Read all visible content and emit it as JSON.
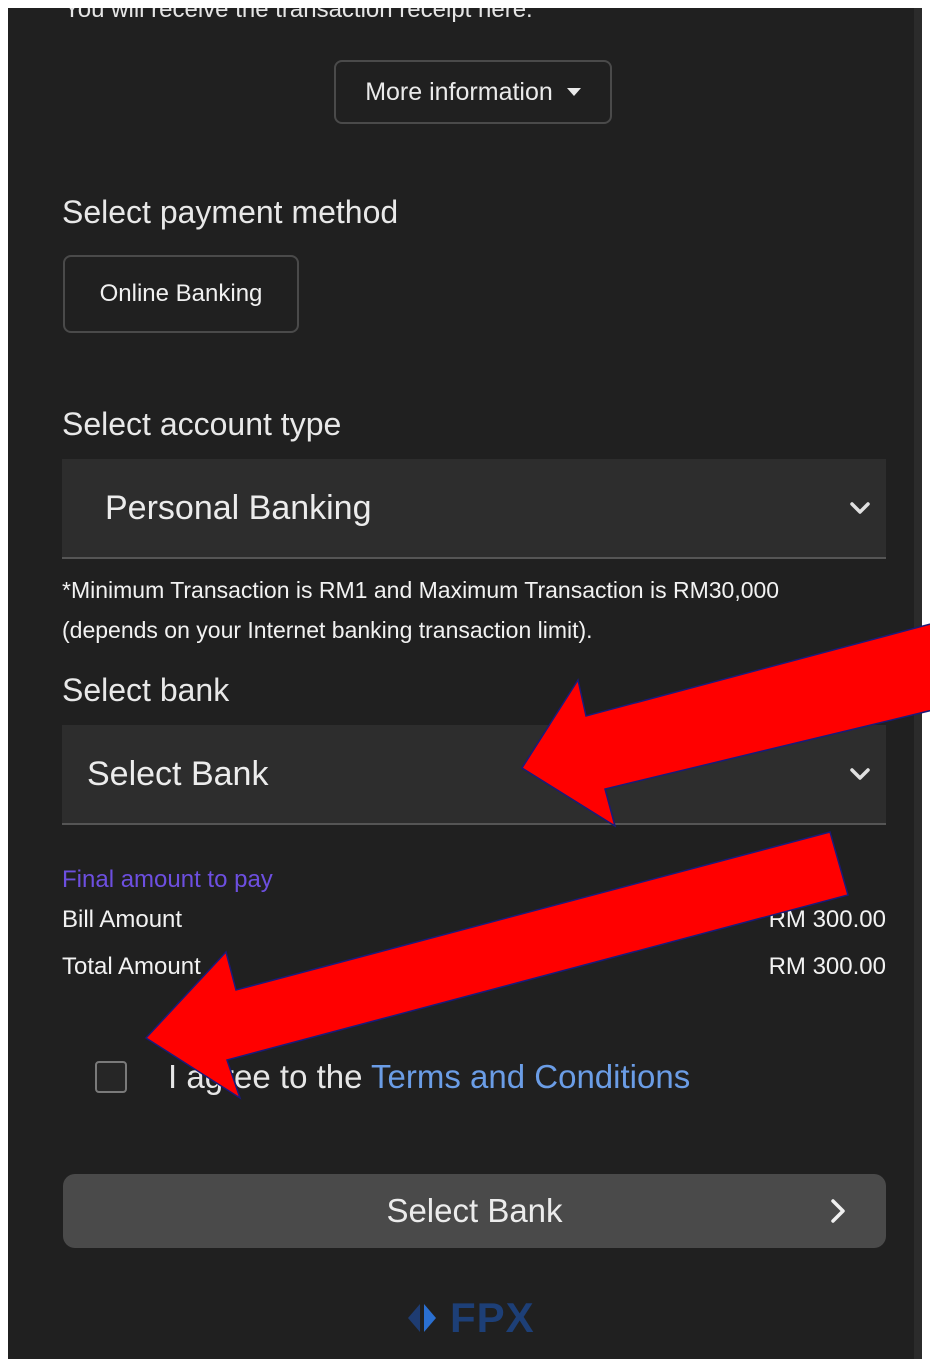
{
  "receipt_note": "You will receive the transaction receipt here.",
  "more_info": {
    "label": "More information"
  },
  "payment_method": {
    "title": "Select payment method",
    "option": "Online Banking"
  },
  "account_type": {
    "title": "Select account type",
    "selected": "Personal Banking"
  },
  "transaction_note": "*Minimum Transaction is RM1 and Maximum Transaction is RM30,000 (depends on your Internet banking transaction limit).",
  "bank": {
    "title": "Select bank",
    "selected": "Select Bank"
  },
  "final_amount": {
    "label": "Final amount to pay",
    "bill_label": "Bill Amount",
    "bill_value": "RM 300.00",
    "total_label": "Total Amount",
    "total_value": "RM 300.00"
  },
  "agree": {
    "prefix": "I agree to the ",
    "link": "Terms and Conditions"
  },
  "submit": {
    "label": "Select Bank"
  },
  "logo": {
    "text": "FPX"
  },
  "colors": {
    "panel_bg": "#202020",
    "accent_link": "#6b9de6",
    "final_label": "#6d4fe0",
    "annotation_arrow": "#ff0000"
  }
}
